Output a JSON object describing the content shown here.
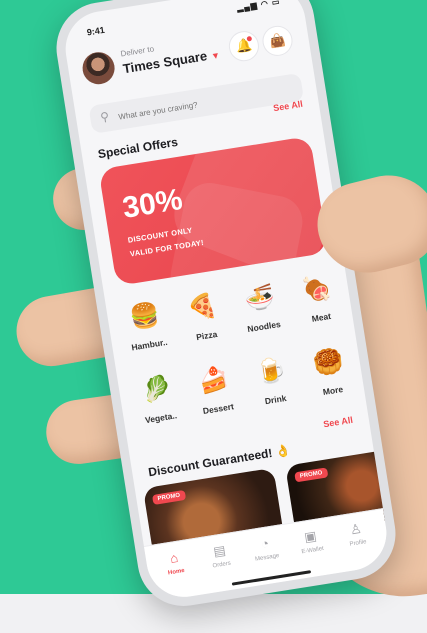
{
  "colors": {
    "background": "#2ec995",
    "accent": "#f0484f"
  },
  "status_bar": {
    "time": "9:41",
    "indicators": "signal wifi battery"
  },
  "header": {
    "deliver_label": "Deliver to",
    "location": "Times Square",
    "notification_icon": "bell-icon",
    "cart_icon": "bag-icon"
  },
  "search": {
    "placeholder": "What are you craving?"
  },
  "special_offers": {
    "title": "Special Offers",
    "see_all": "See All",
    "banner": {
      "percent": "30%",
      "line1": "DISCOUNT ONLY",
      "line2": "VALID FOR TODAY!"
    }
  },
  "categories": [
    {
      "label": "Hambur..",
      "icon": "🍔"
    },
    {
      "label": "Pizza",
      "icon": "🍕"
    },
    {
      "label": "Noodles",
      "icon": "🍜"
    },
    {
      "label": "Meat",
      "icon": "🍖"
    },
    {
      "label": "Vegeta..",
      "icon": "🥬"
    },
    {
      "label": "Dessert",
      "icon": "🍰"
    },
    {
      "label": "Drink",
      "icon": "🍺"
    },
    {
      "label": "More",
      "icon": "🥮"
    }
  ],
  "discount": {
    "title": "Discount Guaranteed! 👌",
    "see_all": "See All",
    "promo_tag": "PROMO"
  },
  "tabs": [
    {
      "label": "Home",
      "icon": "⌂"
    },
    {
      "label": "Orders",
      "icon": "▤"
    },
    {
      "label": "Message",
      "icon": "◔"
    },
    {
      "label": "E-Wallet",
      "icon": "▣"
    },
    {
      "label": "Profile",
      "icon": "♙"
    }
  ]
}
